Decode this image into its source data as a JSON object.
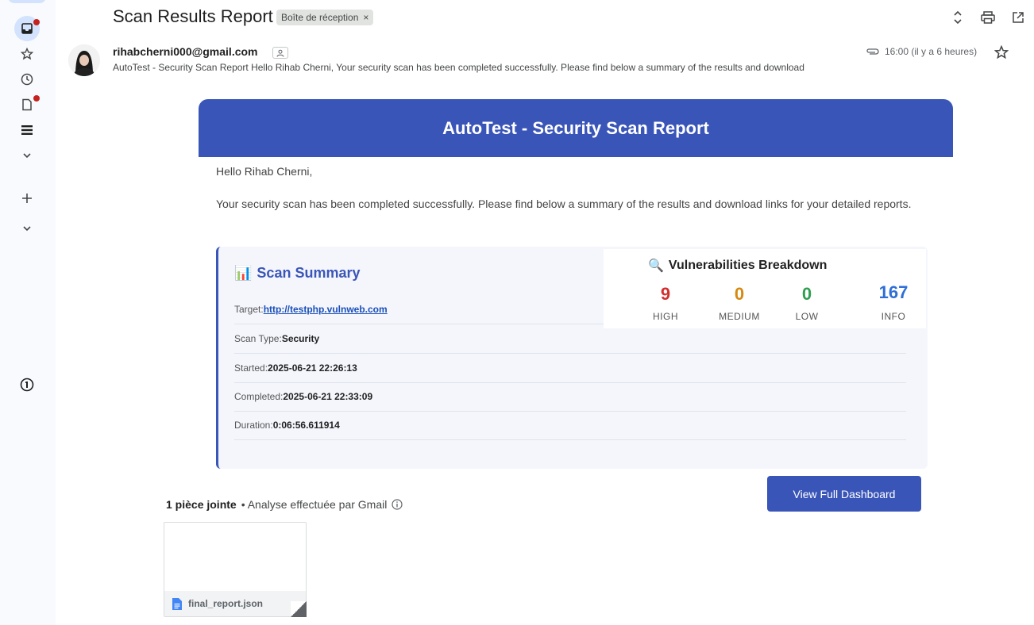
{
  "header": {
    "title": "Scan Results Report",
    "label": "Boîte de réception",
    "label_close": "×"
  },
  "message": {
    "sender": "rihabcherni000@gmail.com",
    "snippet": "AutoTest - Security Scan Report Hello Rihab Cherni, Your security scan has been completed successfully. Please find below a summary of the results and download",
    "time": "16:00 (il y a 6 heures)"
  },
  "email": {
    "banner": "AutoTest - Security Scan Report",
    "greeting": "Hello Rihab Cherni,",
    "intro": "Your security scan has been completed successfully. Please find below a summary of the results and download links for your detailed reports.",
    "summary": {
      "icon": "📊",
      "title": "Scan Summary",
      "target_label": "Target:",
      "target_value": "http://testphp.vulnweb.com",
      "scan_type_label": "Scan Type:",
      "scan_type_value": "Security",
      "started_label": "Started:",
      "started_value": "2025-06-21 22:26:13",
      "completed_label": "Completed:",
      "completed_value": "2025-06-21 22:33:09",
      "duration_label": "Duration:",
      "duration_value": "0:06:56.611914"
    },
    "vulns": {
      "icon": "🔍",
      "title": "Vulnerabilities Breakdown",
      "items": [
        {
          "count": "9",
          "label": "HIGH",
          "color": "#d32f2f"
        },
        {
          "count": "0",
          "label": "MEDIUM",
          "color": "#d68910"
        },
        {
          "count": "0",
          "label": "LOW",
          "color": "#2e9e4f"
        },
        {
          "count": "167",
          "label": "INFO",
          "color": "#2f6fd6"
        }
      ]
    },
    "dashboard_button": "View Full Dashboard"
  },
  "attachments": {
    "count_label": "1 pièce jointe",
    "scan_note": "• Analyse effectuée par Gmail",
    "file_name": "final_report.json"
  },
  "colors": {
    "brand": "#3a55b8",
    "accent_light": "#d3e3fd"
  }
}
